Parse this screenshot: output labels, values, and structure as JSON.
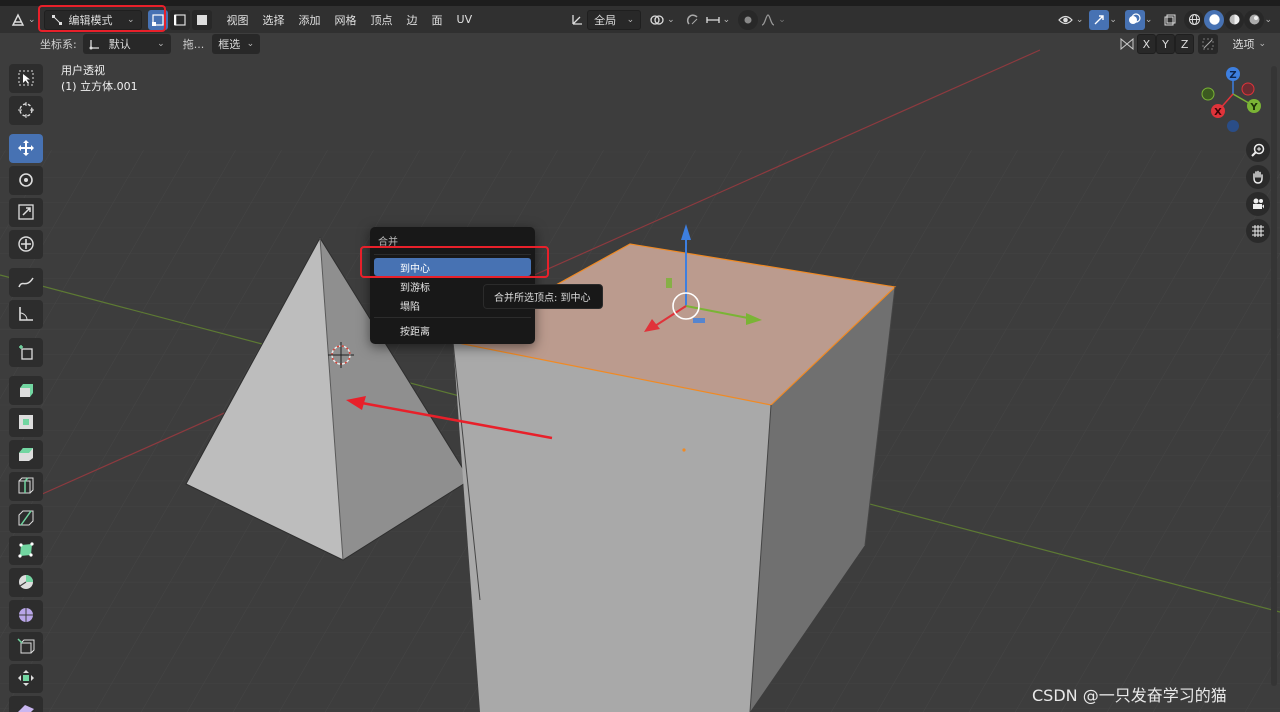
{
  "header": {
    "mode_label": "编辑模式",
    "menus": [
      "视图",
      "选择",
      "添加",
      "网格",
      "顶点",
      "边",
      "面",
      "UV"
    ],
    "transform_orientation": "全局"
  },
  "toolbar2": {
    "coord_label": "坐标系:",
    "coord_value": "默认",
    "drag_label": "拖...",
    "select_value": "框选",
    "axis_x": "X",
    "axis_y": "Y",
    "axis_z": "Z",
    "options_label": "选项"
  },
  "viewport": {
    "view_name": "用户透视",
    "object_name": "(1) 立方体.001"
  },
  "gizmo": {
    "z": "Z",
    "y": "Y",
    "x": "X"
  },
  "context_menu": {
    "title": "合并",
    "items": [
      "到中心",
      "到游标",
      "塌陷",
      "按距离"
    ],
    "hovered_index": 0
  },
  "tooltip": {
    "text": "合并所选顶点:  到中心"
  },
  "watermark": "CSDN @一只发奋学习的猫",
  "colors": {
    "accent": "#4772b3",
    "highlight_box": "#e8202a",
    "selection_orange": "#f08a24",
    "axis_red": "#e0333a",
    "axis_green": "#7ab435",
    "axis_blue": "#3d7fe0"
  }
}
